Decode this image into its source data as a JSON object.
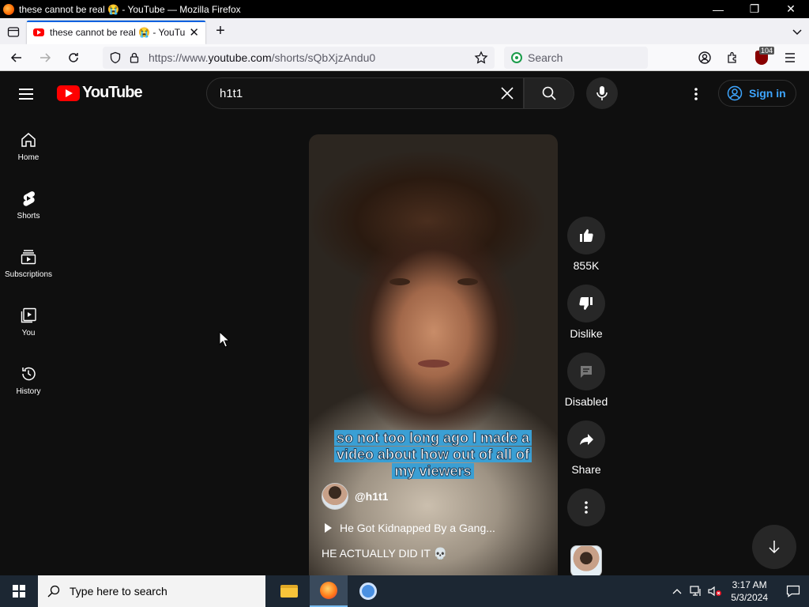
{
  "window": {
    "title": "these cannot be real 😭 - YouTube — Mozilla Firefox",
    "minimize": "—",
    "restore": "❐",
    "close": "✕"
  },
  "tabs": [
    {
      "title": "these cannot be real 😭 - YouTube",
      "close": "✕"
    }
  ],
  "tabstrip": {
    "new_tab": "+",
    "list_all": "⌄"
  },
  "navbar": {
    "url_prefix": "https://www.",
    "url_domain": "youtube.com",
    "url_path": "/shorts/sQbXjzAndu0",
    "search_placeholder": "Search",
    "extension_badge": "104"
  },
  "youtube": {
    "logo_text": "YouTube",
    "search_query": "h1t1",
    "signin_label": "Sign in",
    "sidebar": [
      {
        "id": "home",
        "label": "Home",
        "icon": "home-icon"
      },
      {
        "id": "shorts",
        "label": "Shorts",
        "icon": "shorts-icon"
      },
      {
        "id": "subscriptions",
        "label": "Subscriptions",
        "icon": "subscriptions-icon"
      },
      {
        "id": "you",
        "label": "You",
        "icon": "you-icon"
      },
      {
        "id": "history",
        "label": "History",
        "icon": "history-icon"
      }
    ],
    "short": {
      "caption": "so not too long ago I made a video about how out of all of my viewers",
      "channel_handle": "@h1t1",
      "playlist_title": "He Got Kidnapped By a Gang...",
      "description": "HE ACTUALLY DID IT 💀"
    },
    "actions": {
      "like_count": "855K",
      "dislike_label": "Dislike",
      "comments_label": "Disabled",
      "share_label": "Share"
    }
  },
  "taskbar": {
    "search_placeholder": "Type here to search",
    "time": "3:17 AM",
    "date": "5/3/2024"
  }
}
